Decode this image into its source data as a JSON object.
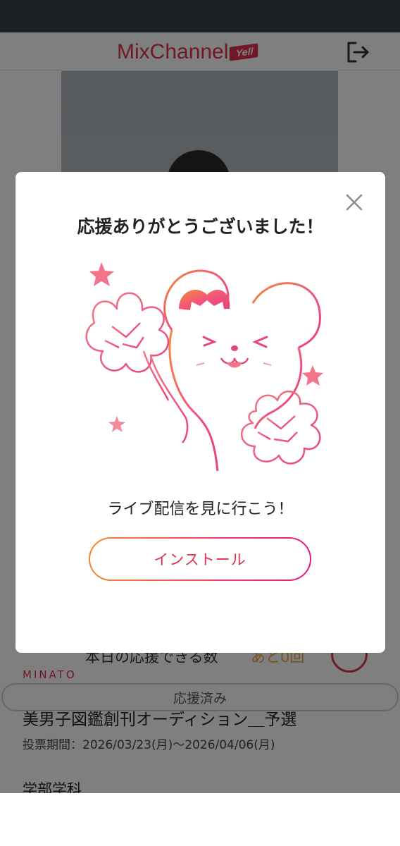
{
  "header": {
    "logo_text": "MixChannel",
    "logo_badge": "Yell",
    "logout_icon": "logout-icon"
  },
  "background": {
    "count_label": "本日の応援できる数",
    "count_value": "あと0回",
    "group_name": "MINATO",
    "supported_button": "応援済み",
    "audition_title": "美男子図鑑創刊オーディション＿予選",
    "vote_period": "投票期間：2026/03/23(月)〜2026/04/06(月)",
    "section_heading": "学部学科"
  },
  "modal": {
    "close_icon": "close-icon",
    "title": "応援ありがとうございました！",
    "illustration": "cheering-mascot-illustration",
    "message": "ライブ配信を見に行こう！",
    "install_button": "インストール"
  },
  "colors": {
    "brand": "#e3304f",
    "accent_orange": "#f08a2e",
    "accent_pink": "#e4197f",
    "count_value": "#e8a23a",
    "status_bar": "#1c1f24"
  }
}
